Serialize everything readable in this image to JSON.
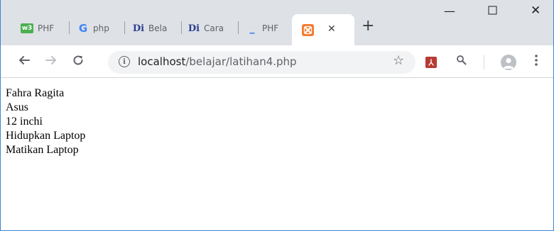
{
  "tabs": [
    {
      "title": "PHF",
      "icon": "w3schools-icon",
      "badge": "w3"
    },
    {
      "title": "php",
      "icon": "google-icon",
      "badge": "G"
    },
    {
      "title": "Bela",
      "icon": "dicoding-icon",
      "badge": "Di"
    },
    {
      "title": "Cara",
      "icon": "dicoding-icon",
      "badge": "Di"
    },
    {
      "title": "PHF",
      "icon": "dash-icon",
      "badge": "_"
    }
  ],
  "active_tab": {
    "icon": "xampp-icon",
    "badge": "&"
  },
  "toolbar": {
    "url_host": "localhost",
    "url_path": "/belajar/latihan4.php",
    "info_glyph": "i"
  },
  "content": {
    "lines": [
      "Fahra Ragita",
      "Asus",
      "12 inchi",
      "Hidupkan Laptop",
      "Matikan Laptop"
    ]
  },
  "colors": {
    "tabstrip": "#dee1e6",
    "window_border": "#3c84d6",
    "w3_green": "#4caf50",
    "google_blue": "#4285f4",
    "dicoding_blue": "#2c3e8f",
    "xampp_orange": "#f47c30",
    "pdf_red": "#b83b32"
  }
}
